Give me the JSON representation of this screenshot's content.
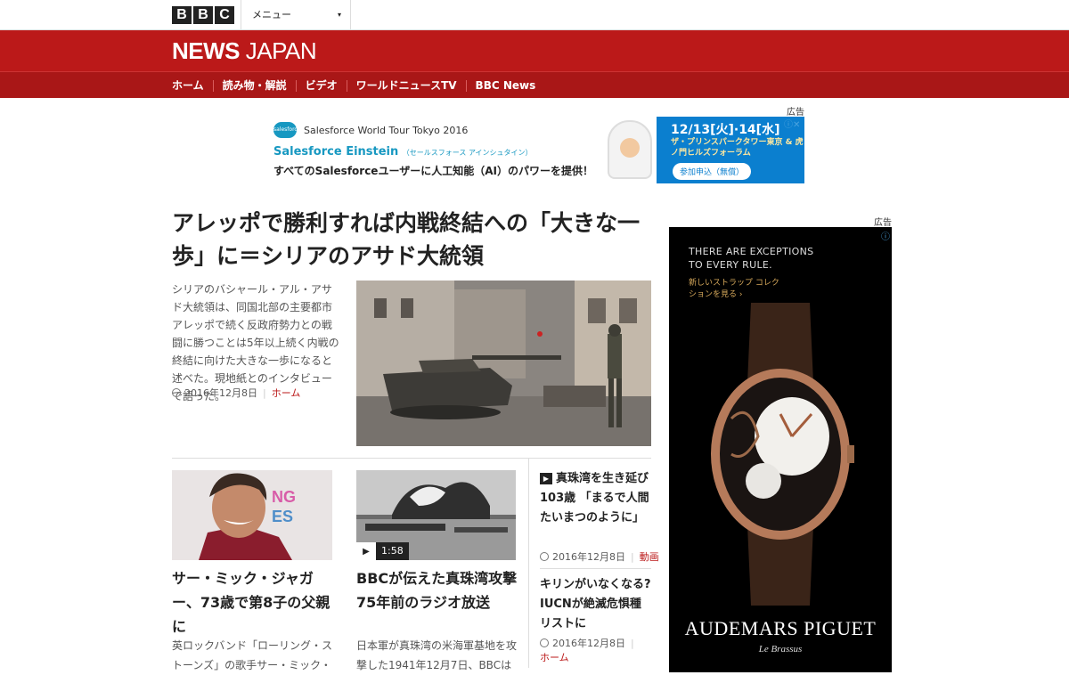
{
  "topbar": {
    "logo_letters": [
      "B",
      "B",
      "C"
    ],
    "menu_label": "メニュー",
    "menu_caret": "▾"
  },
  "header": {
    "brand_bold": "NEWS",
    "brand_light": " JAPAN"
  },
  "nav": {
    "items": [
      "ホーム",
      "読み物・解説",
      "ビデオ",
      "ワールドニュースTV",
      "BBC News"
    ]
  },
  "ads": {
    "label": "広告",
    "top": {
      "logo": "salesforce",
      "line1": "Salesforce World Tour Tokyo 2016",
      "line2": "Salesforce Einstein",
      "line2_small": "（セールスフォース アインシュタイン）",
      "line3": "すべてのSalesforceユーザーに人工知能（AI）のパワーを提供！",
      "date": "12/13[火]·14[水]",
      "venue": "ザ・プリンスパークタワー東京 & 虎ノ門ヒルズフォーラム",
      "cta": "参加申込（無償）",
      "close_icons": "ⓘ✕"
    },
    "side": {
      "headline": "THERE ARE EXCEPTIONS TO EVERY RULE.",
      "sub": "新しいストラップ コレクションを見る ›",
      "brand": "AUDEMARS PIGUET",
      "brand_sub": "Le Brassus",
      "info_icon": "ⓘ"
    }
  },
  "lead": {
    "title": "アレッポで勝利すれば内戦終結への「大きな一歩」に＝シリアのアサド大統領",
    "summary": "シリアのバシャール・アル・アサド大統領は、同国北部の主要都市アレッポで続く反政府勢力との戦闘に勝つことは5年以上続く内戦の終結に向けた大きな一歩になると述べた。現地紙とのインタビューで語った。",
    "date": "2016年12月8日",
    "section": "ホーム"
  },
  "cards": [
    {
      "title": "サー・ミック・ジャガー、73歳で第8子の父親に",
      "summary": "英ロックバンド「ローリング・ストーンズ」の歌手サー・ミック・"
    },
    {
      "title": "BBCが伝えた真珠湾攻撃 75年前のラジオ放送",
      "summary": "日本軍が真珠湾の米海軍基地を攻撃した1941年12月7日、BBCは",
      "duration": "1:58",
      "play": "▶"
    }
  ],
  "side_stories": [
    {
      "play": "▶",
      "title": "真珠湾を生き延び103歳 「まるで人間たいまつのように」",
      "date": "2016年12月8日",
      "section": "動画"
    },
    {
      "title": "キリンがいなくなる? IUCNが絶滅危惧種リストに",
      "date": "2016年12月8日",
      "section": "ホーム"
    }
  ]
}
